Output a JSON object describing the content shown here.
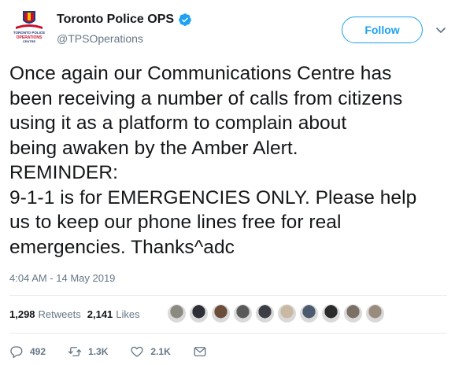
{
  "account": {
    "display_name": "Toronto Police OPS",
    "handle": "@TPSOperations",
    "avatar_text": "TORONTO POLICE OPERATIONS CENTRE",
    "verified": true
  },
  "follow_label": "Follow",
  "tweet_text": "Once again our Communications Centre has\nbeen receiving a number of calls from citizens\nusing it as a platform to complain about\nbeing awaken by the Amber Alert.\nREMINDER:\n9-1-1 is for EMERGENCIES ONLY. Please help\nus to keep our phone lines free for real\nemergencies. Thanks^adc",
  "timestamp": "4:04 AM - 14 May 2019",
  "stats": {
    "retweets_count": "1,298",
    "retweets_label": "Retweets",
    "likes_count": "2,141",
    "likes_label": "Likes"
  },
  "liker_avatar_colors": [
    "#8a8a80",
    "#2f2f38",
    "#6b4e3a",
    "#5a5a5a",
    "#3d3d45",
    "#c9b9a3",
    "#4b5a6e",
    "#2b2b2b",
    "#7c6f64",
    "#9a8c7d"
  ],
  "actions": {
    "replies": "492",
    "retweets": "1.3K",
    "likes": "2.1K"
  },
  "colors": {
    "accent": "#1da1f2",
    "secondary_text": "#657786",
    "divider": "#e6ecf0"
  }
}
